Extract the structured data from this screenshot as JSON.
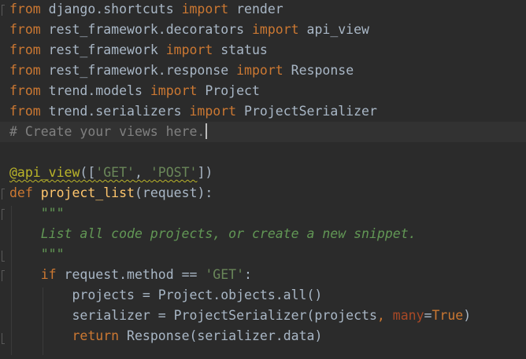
{
  "editor": {
    "lines": [
      {
        "parts": [
          {
            "t": "from",
            "c": "kw"
          },
          {
            "t": " django.shortcuts ",
            "c": "ident"
          },
          {
            "t": "import",
            "c": "kw"
          },
          {
            "t": " render",
            "c": "ident"
          }
        ]
      },
      {
        "parts": [
          {
            "t": "from",
            "c": "kw"
          },
          {
            "t": " rest_framework.decorators ",
            "c": "ident"
          },
          {
            "t": "import",
            "c": "kw"
          },
          {
            "t": " api_view",
            "c": "ident"
          }
        ]
      },
      {
        "parts": [
          {
            "t": "from",
            "c": "kw"
          },
          {
            "t": " rest_framework ",
            "c": "ident"
          },
          {
            "t": "import",
            "c": "kw"
          },
          {
            "t": " status",
            "c": "ident"
          }
        ]
      },
      {
        "parts": [
          {
            "t": "from",
            "c": "kw"
          },
          {
            "t": " rest_framework.response ",
            "c": "ident"
          },
          {
            "t": "import",
            "c": "kw"
          },
          {
            "t": " Response",
            "c": "ident"
          }
        ]
      },
      {
        "parts": [
          {
            "t": "from",
            "c": "kw"
          },
          {
            "t": " trend.models ",
            "c": "ident"
          },
          {
            "t": "import",
            "c": "kw"
          },
          {
            "t": " Project",
            "c": "ident"
          }
        ]
      },
      {
        "parts": [
          {
            "t": "from",
            "c": "kw"
          },
          {
            "t": " trend.serializers ",
            "c": "ident"
          },
          {
            "t": "import",
            "c": "kw"
          },
          {
            "t": " ProjectSerializer",
            "c": "ident"
          }
        ]
      },
      {
        "parts": [
          {
            "t": "# Create your views here.",
            "c": "comment"
          }
        ],
        "caret": true
      },
      {
        "parts": []
      },
      {
        "parts": [
          {
            "t": "@api_view",
            "c": "deco squiggle"
          },
          {
            "t": "([",
            "c": "punct squiggle"
          },
          {
            "t": "'GET'",
            "c": "str squiggle"
          },
          {
            "t": ", ",
            "c": "punct squiggle"
          },
          {
            "t": "'POST'",
            "c": "str squiggle"
          },
          {
            "t": "])",
            "c": "punct"
          }
        ]
      },
      {
        "parts": [
          {
            "t": "def",
            "c": "kw"
          },
          {
            "t": " ",
            "c": "ident"
          },
          {
            "t": "project_list",
            "c": "fn"
          },
          {
            "t": "(request):",
            "c": "punct"
          }
        ]
      },
      {
        "parts": [
          {
            "t": "    \"\"\"",
            "c": "doc"
          }
        ]
      },
      {
        "parts": [
          {
            "t": "    List all code projects, or create a new snippet.",
            "c": "doc"
          }
        ]
      },
      {
        "parts": [
          {
            "t": "    \"\"\"",
            "c": "doc"
          }
        ]
      },
      {
        "parts": [
          {
            "t": "    ",
            "c": "ident"
          },
          {
            "t": "if",
            "c": "kw"
          },
          {
            "t": " request.method == ",
            "c": "ident"
          },
          {
            "t": "'GET'",
            "c": "str"
          },
          {
            "t": ":",
            "c": "punct"
          }
        ]
      },
      {
        "parts": [
          {
            "t": "        projects = Project.objects.all()",
            "c": "ident"
          }
        ]
      },
      {
        "parts": [
          {
            "t": "        serializer = ProjectSerializer(projects",
            "c": "ident"
          },
          {
            "t": ", ",
            "c": "kw"
          },
          {
            "t": "many",
            "c": "param"
          },
          {
            "t": "=",
            "c": "ident"
          },
          {
            "t": "True",
            "c": "kw"
          },
          {
            "t": ")",
            "c": "ident"
          }
        ]
      },
      {
        "parts": [
          {
            "t": "        ",
            "c": "ident"
          },
          {
            "t": "return",
            "c": "kw"
          },
          {
            "t": " Response(serializer.data)",
            "c": "ident"
          }
        ]
      }
    ]
  }
}
